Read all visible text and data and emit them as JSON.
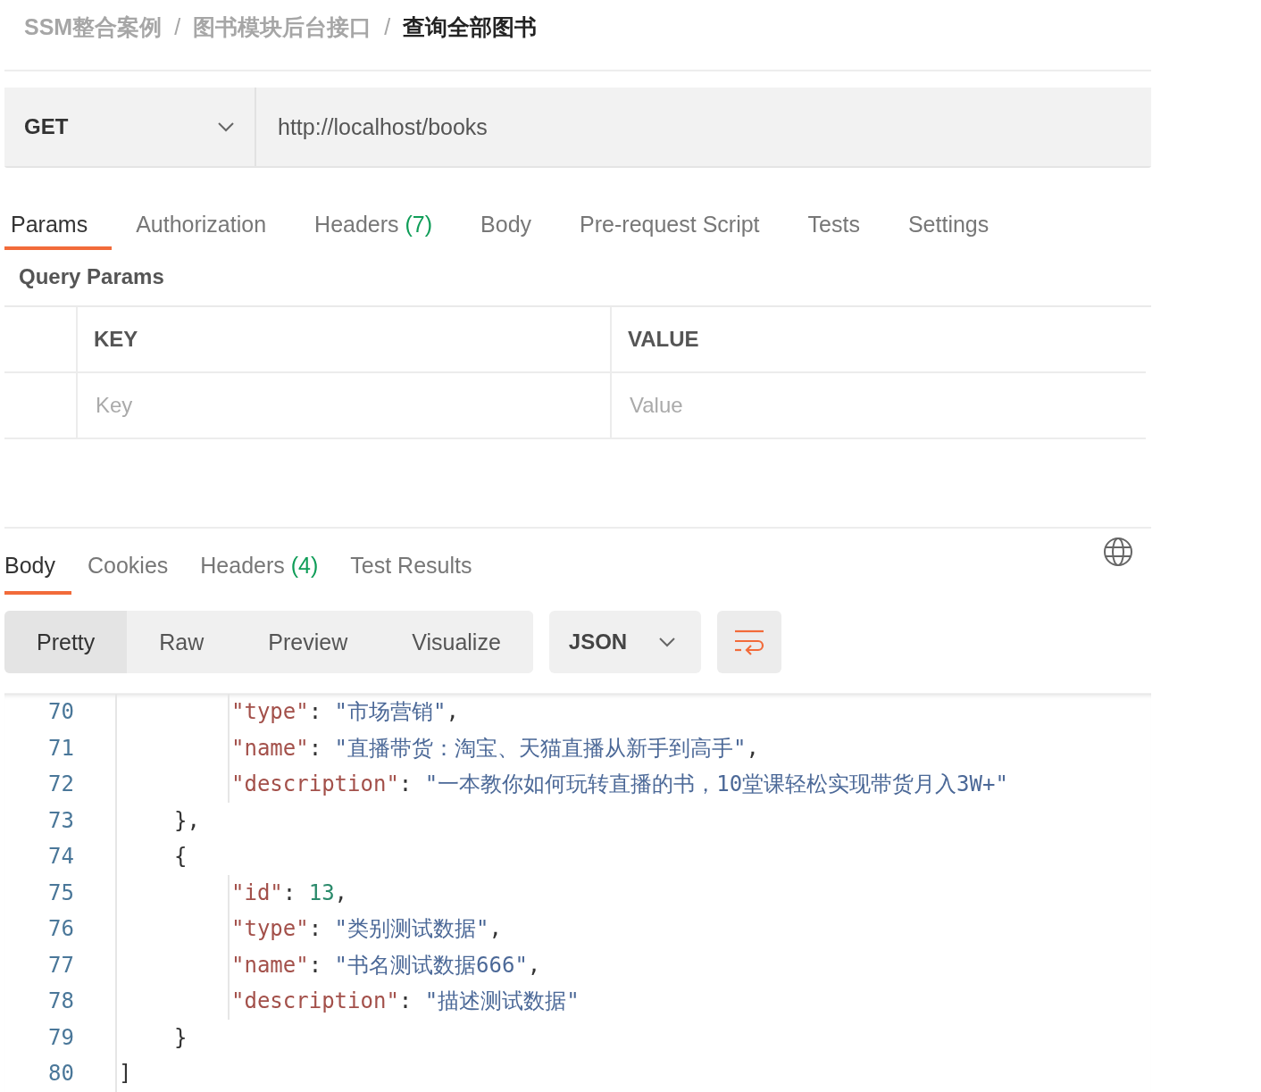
{
  "breadcrumb": [
    {
      "label": "SSM整合案例",
      "current": false
    },
    {
      "label": "图书模块后台接口",
      "current": false
    },
    {
      "label": "查询全部图书",
      "current": true
    }
  ],
  "breadcrumb_separator": "/",
  "request": {
    "method": "GET",
    "url": "http://localhost/books"
  },
  "request_tabs": [
    {
      "label": "Params",
      "selected": true
    },
    {
      "label": "Authorization",
      "selected": false
    },
    {
      "label": "Headers",
      "count": "(7)",
      "selected": false
    },
    {
      "label": "Body",
      "selected": false
    },
    {
      "label": "Pre-request Script",
      "selected": false
    },
    {
      "label": "Tests",
      "selected": false
    },
    {
      "label": "Settings",
      "selected": false
    }
  ],
  "query_params": {
    "title": "Query Params",
    "columns": [
      "KEY",
      "VALUE"
    ],
    "placeholders": [
      "Key",
      "Value"
    ]
  },
  "response_tabs": [
    {
      "label": "Body",
      "selected": true
    },
    {
      "label": "Cookies",
      "selected": false
    },
    {
      "label": "Headers",
      "count": "(4)",
      "selected": false
    },
    {
      "label": "Test Results",
      "selected": false
    }
  ],
  "view_modes": [
    {
      "label": "Pretty",
      "selected": true
    },
    {
      "label": "Raw",
      "selected": false
    },
    {
      "label": "Preview",
      "selected": false
    },
    {
      "label": "Visualize",
      "selected": false
    }
  ],
  "format": "JSON",
  "code": [
    {
      "number": "70",
      "kind": "field",
      "tokens": [
        {
          "kind": "key",
          "text": "\"type\""
        },
        {
          "kind": "punct",
          "text": ": "
        },
        {
          "kind": "string",
          "text": "\"市场营销\""
        },
        {
          "kind": "punct",
          "text": ","
        }
      ]
    },
    {
      "number": "71",
      "kind": "field",
      "tokens": [
        {
          "kind": "key",
          "text": "\"name\""
        },
        {
          "kind": "punct",
          "text": ": "
        },
        {
          "kind": "string",
          "text": "\"直播带货：淘宝、天猫直播从新手到高手\""
        },
        {
          "kind": "punct",
          "text": ","
        }
      ]
    },
    {
      "number": "72",
      "kind": "field",
      "tokens": [
        {
          "kind": "key",
          "text": "\"description\""
        },
        {
          "kind": "punct",
          "text": ": "
        },
        {
          "kind": "string",
          "text": "\"一本教你如何玩转直播的书，10堂课轻松实现带货月入3W+\""
        }
      ]
    },
    {
      "number": "73",
      "kind": "brace",
      "tokens": [
        {
          "kind": "punct",
          "text": "},"
        }
      ]
    },
    {
      "number": "74",
      "kind": "brace",
      "tokens": [
        {
          "kind": "punct",
          "text": "{"
        }
      ]
    },
    {
      "number": "75",
      "kind": "field",
      "tokens": [
        {
          "kind": "key",
          "text": "\"id\""
        },
        {
          "kind": "punct",
          "text": ": "
        },
        {
          "kind": "number",
          "text": "13"
        },
        {
          "kind": "punct",
          "text": ","
        }
      ]
    },
    {
      "number": "76",
      "kind": "field",
      "tokens": [
        {
          "kind": "key",
          "text": "\"type\""
        },
        {
          "kind": "punct",
          "text": ": "
        },
        {
          "kind": "string",
          "text": "\"类别测试数据\""
        },
        {
          "kind": "punct",
          "text": ","
        }
      ]
    },
    {
      "number": "77",
      "kind": "field",
      "tokens": [
        {
          "kind": "key",
          "text": "\"name\""
        },
        {
          "kind": "punct",
          "text": ": "
        },
        {
          "kind": "string",
          "text": "\"书名测试数据666\""
        },
        {
          "kind": "punct",
          "text": ","
        }
      ]
    },
    {
      "number": "78",
      "kind": "field",
      "tokens": [
        {
          "kind": "key",
          "text": "\"description\""
        },
        {
          "kind": "punct",
          "text": ": "
        },
        {
          "kind": "string",
          "text": "\"描述测试数据\""
        }
      ]
    },
    {
      "number": "79",
      "kind": "brace",
      "tokens": [
        {
          "kind": "punct",
          "text": "}"
        }
      ]
    },
    {
      "number": "80",
      "kind": "root",
      "tokens": [
        {
          "kind": "punct",
          "text": "]"
        }
      ]
    }
  ]
}
